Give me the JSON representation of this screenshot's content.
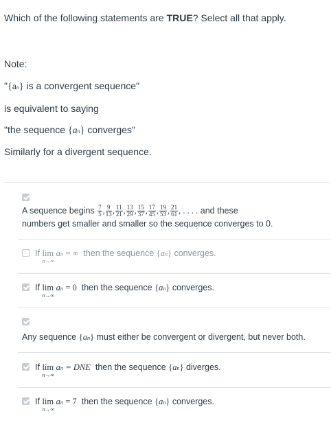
{
  "question": {
    "prefix": "Which of the following statements are ",
    "emph": "TRUE",
    "suffix": "? Select all that apply."
  },
  "note": {
    "label": "Note:",
    "line1_open": "\"",
    "line1_set": "{a",
    "line1_sub": "n",
    "line1_close": "}",
    "line1_rest": " is a convergent sequence\"",
    "line2": "is equivalent to saying",
    "line3_pre": "\"the sequence ",
    "line3_post": " converges\"",
    "line4": "Similarly for a divergent sequence."
  },
  "options": [
    {
      "checked": true,
      "text_pre": "A sequence begins",
      "fractions": [
        [
          "7",
          "5"
        ],
        [
          "9",
          "13"
        ],
        [
          "11",
          "21"
        ],
        [
          "13",
          "29"
        ],
        [
          "15",
          "37"
        ],
        [
          "17",
          "45"
        ],
        [
          "19",
          "53"
        ],
        [
          "21",
          "61"
        ]
      ],
      "ellipsis": ", . . . .",
      "text_mid": "and these",
      "text_line2": "numbers get smaller and smaller so the sequence converges to 0."
    },
    {
      "checked": false,
      "lim": "lim",
      "lim_sub": "n→∞",
      "var": "a",
      "var_sub": "n",
      "rel": "= ∞",
      "text": "then the sequence",
      "tail": "converges."
    },
    {
      "checked": true,
      "lim": "lim",
      "lim_sub": "n→∞",
      "var": "a",
      "var_sub": "n",
      "rel": "= 0",
      "text": "then the sequence",
      "tail": "converges."
    },
    {
      "checked": true,
      "text_pre": "Any sequence",
      "text_post": "must either be convergent or divergent, but never both."
    },
    {
      "checked": true,
      "lim": "lim",
      "lim_sub": "n→∞",
      "var": "a",
      "var_sub": "n",
      "rel": "= DNE",
      "text": "then the sequence",
      "tail": "diverges."
    },
    {
      "checked": true,
      "lim": "lim",
      "lim_sub": "n→∞",
      "var": "a",
      "var_sub": "n",
      "rel": "= 7",
      "text": "then the sequence",
      "tail": "converges."
    }
  ],
  "if_label": "If"
}
